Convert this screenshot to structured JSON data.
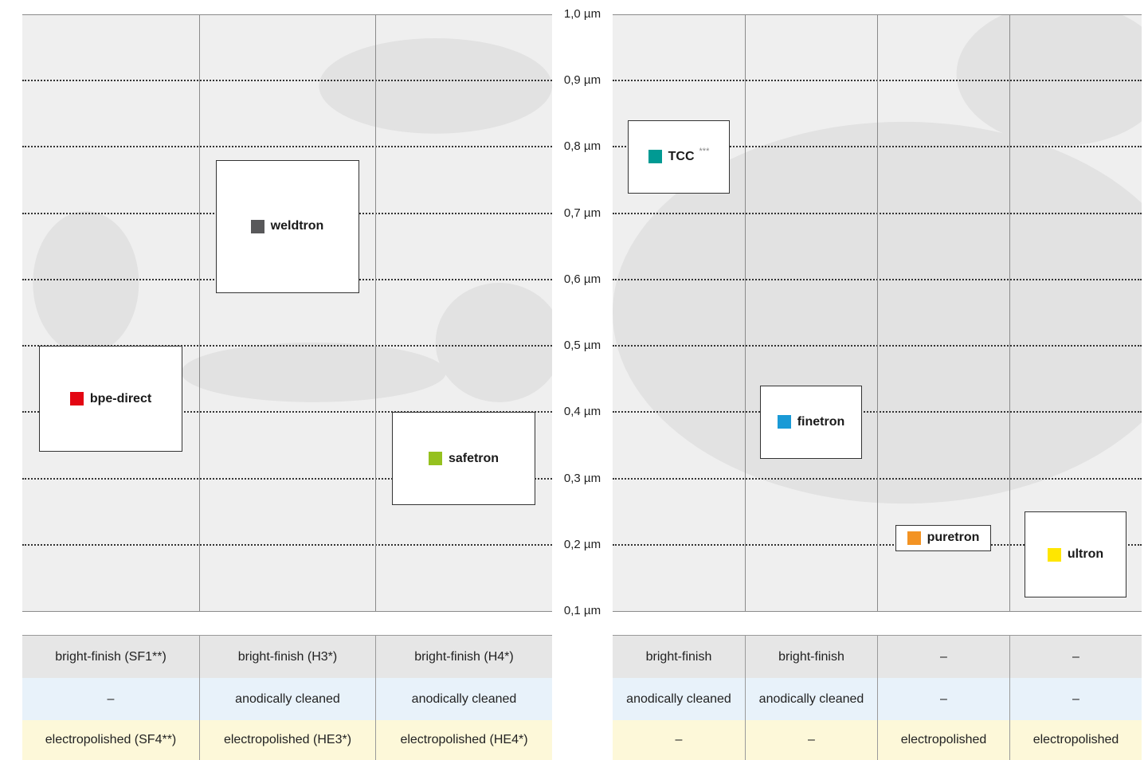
{
  "chart_data": [
    {
      "type": "scatter",
      "y_unit": "µm",
      "ylim": [
        0.1,
        1.0
      ],
      "y_ticks": [
        "1,0 µm",
        "0,9 µm",
        "0,8 µm",
        "0,7 µm",
        "0,6 µm",
        "0,5 µm",
        "0,4 µm",
        "0,3 µm",
        "0,2 µm",
        "0,1 µm"
      ],
      "grid": true,
      "columns": 3,
      "items": [
        {
          "name": "bpe-direct",
          "color": "#e30613",
          "column": 0,
          "y_top": 0.5,
          "y_bottom": 0.34
        },
        {
          "name": "weldtron",
          "color": "#58585a",
          "column": 1,
          "y_top": 0.78,
          "y_bottom": 0.58
        },
        {
          "name": "safetron",
          "color": "#95c11f",
          "column": 2,
          "y_top": 0.4,
          "y_bottom": 0.26
        }
      ],
      "table": [
        [
          "bright-finish (SF1**)",
          "bright-finish (H3*)",
          "bright-finish (H4*)"
        ],
        [
          "–",
          "anodically cleaned",
          "anodically cleaned"
        ],
        [
          "electropolished (SF4**)",
          "electropolished (HE3*)",
          "electropolished (HE4*)"
        ]
      ]
    },
    {
      "type": "scatter",
      "y_unit": "µm",
      "ylim": [
        0.1,
        1.0
      ],
      "grid": true,
      "columns": 4,
      "items": [
        {
          "name": "TCC",
          "note": "***",
          "color": "#009a93",
          "column": 0,
          "y_top": 0.84,
          "y_bottom": 0.73
        },
        {
          "name": "finetron",
          "color": "#1a9ad6",
          "column": 1,
          "y_top": 0.44,
          "y_bottom": 0.33
        },
        {
          "name": "puretron",
          "color": "#f39323",
          "column": 2,
          "y_top": 0.23,
          "y_bottom": 0.19
        },
        {
          "name": "ultron",
          "color": "#ffe600",
          "column": 3,
          "y_top": 0.25,
          "y_bottom": 0.12
        }
      ],
      "table": [
        [
          "bright-finish",
          "bright-finish",
          "–",
          "–"
        ],
        [
          "anodically cleaned",
          "anodically cleaned",
          "–",
          "–"
        ],
        [
          "–",
          "–",
          "electropolished",
          "electropolished"
        ]
      ]
    }
  ]
}
